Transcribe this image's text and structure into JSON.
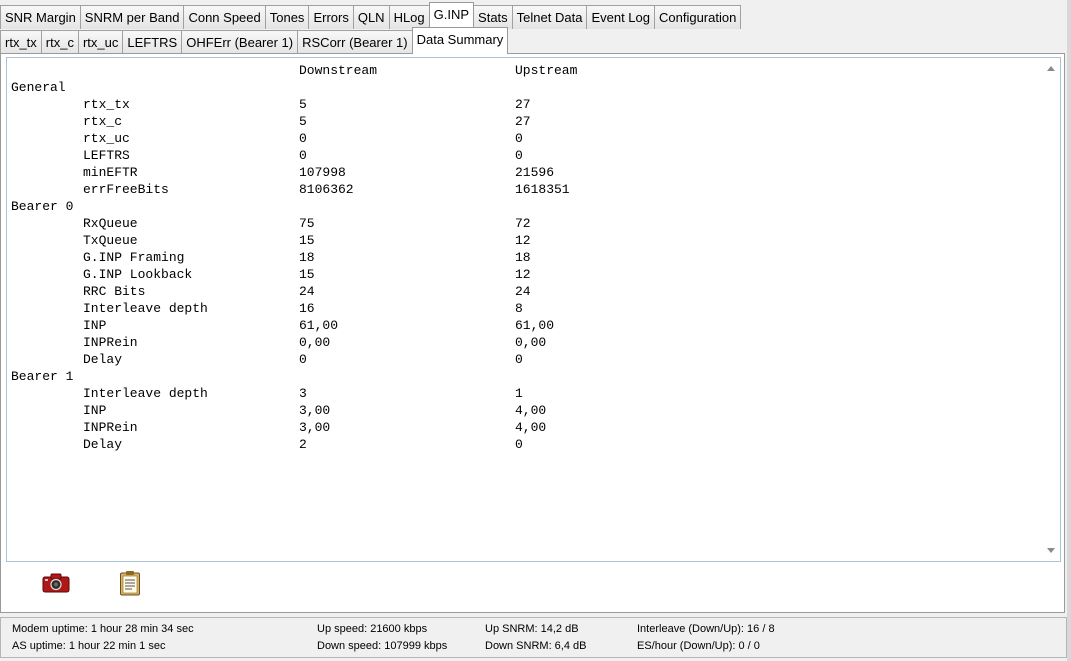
{
  "main_tabs": [
    "SNR Margin",
    "SNRM per Band",
    "Conn Speed",
    "Tones",
    "Errors",
    "QLN",
    "HLog",
    "G.INP",
    "Stats",
    "Telnet Data",
    "Event Log",
    "Configuration"
  ],
  "main_active": "G.INP",
  "sub_tabs": [
    "rtx_tx",
    "rtx_c",
    "rtx_uc",
    "LEFTRS",
    "OHFErr (Bearer 1)",
    "RSCorr (Bearer 1)",
    "Data Summary"
  ],
  "sub_active": "Data Summary",
  "summary": {
    "header": {
      "downstream": "Downstream",
      "upstream": "Upstream"
    },
    "sections": [
      {
        "title": "General",
        "rows": [
          {
            "label": "rtx_tx",
            "down": "5",
            "up": "27"
          },
          {
            "label": "rtx_c",
            "down": "5",
            "up": "27"
          },
          {
            "label": "rtx_uc",
            "down": "0",
            "up": "0"
          },
          {
            "label": "LEFTRS",
            "down": "0",
            "up": "0"
          },
          {
            "label": "minEFTR",
            "down": "107998",
            "up": "21596"
          },
          {
            "label": "errFreeBits",
            "down": "8106362",
            "up": "1618351"
          }
        ]
      },
      {
        "title": "Bearer 0",
        "rows": [
          {
            "label": "RxQueue",
            "down": "75",
            "up": "72"
          },
          {
            "label": "TxQueue",
            "down": "15",
            "up": "12"
          },
          {
            "label": "G.INP Framing",
            "down": "18",
            "up": "18"
          },
          {
            "label": "G.INP Lookback",
            "down": "15",
            "up": "12"
          },
          {
            "label": "RRC Bits",
            "down": "24",
            "up": "24"
          },
          {
            "label": "Interleave depth",
            "down": "16",
            "up": "8"
          },
          {
            "label": "INP",
            "down": "61,00",
            "up": "61,00"
          },
          {
            "label": "INPRein",
            "down": "0,00",
            "up": "0,00"
          },
          {
            "label": "Delay",
            "down": "0",
            "up": "0"
          }
        ]
      },
      {
        "title": "Bearer 1",
        "rows": [
          {
            "label": "Interleave depth",
            "down": "3",
            "up": "1"
          },
          {
            "label": "INP",
            "down": "3,00",
            "up": "4,00"
          },
          {
            "label": "INPRein",
            "down": "3,00",
            "up": "4,00"
          },
          {
            "label": "Delay",
            "down": "2",
            "up": "0"
          }
        ]
      }
    ]
  },
  "toolbar": {
    "icons": [
      "camera-icon",
      "clipboard-icon"
    ]
  },
  "status": {
    "modem_uptime": "Modem uptime:  1 hour 28 min 34 sec",
    "as_uptime": "AS uptime:  1 hour 22 min 1 sec",
    "up_speed": "Up speed: 21600 kbps",
    "down_speed": "Down speed: 107999 kbps",
    "up_snrm": "Up SNRM: 14,2 dB",
    "down_snrm": "Down SNRM: 6,4 dB",
    "interleave": "Interleave (Down/Up): 16 / 8",
    "es_hour": "ES/hour (Down/Up): 0 / 0"
  },
  "colors": {
    "panel_border": "#a9c4d8",
    "camera": "#b01818",
    "clipboard": "#8a6a1e"
  }
}
